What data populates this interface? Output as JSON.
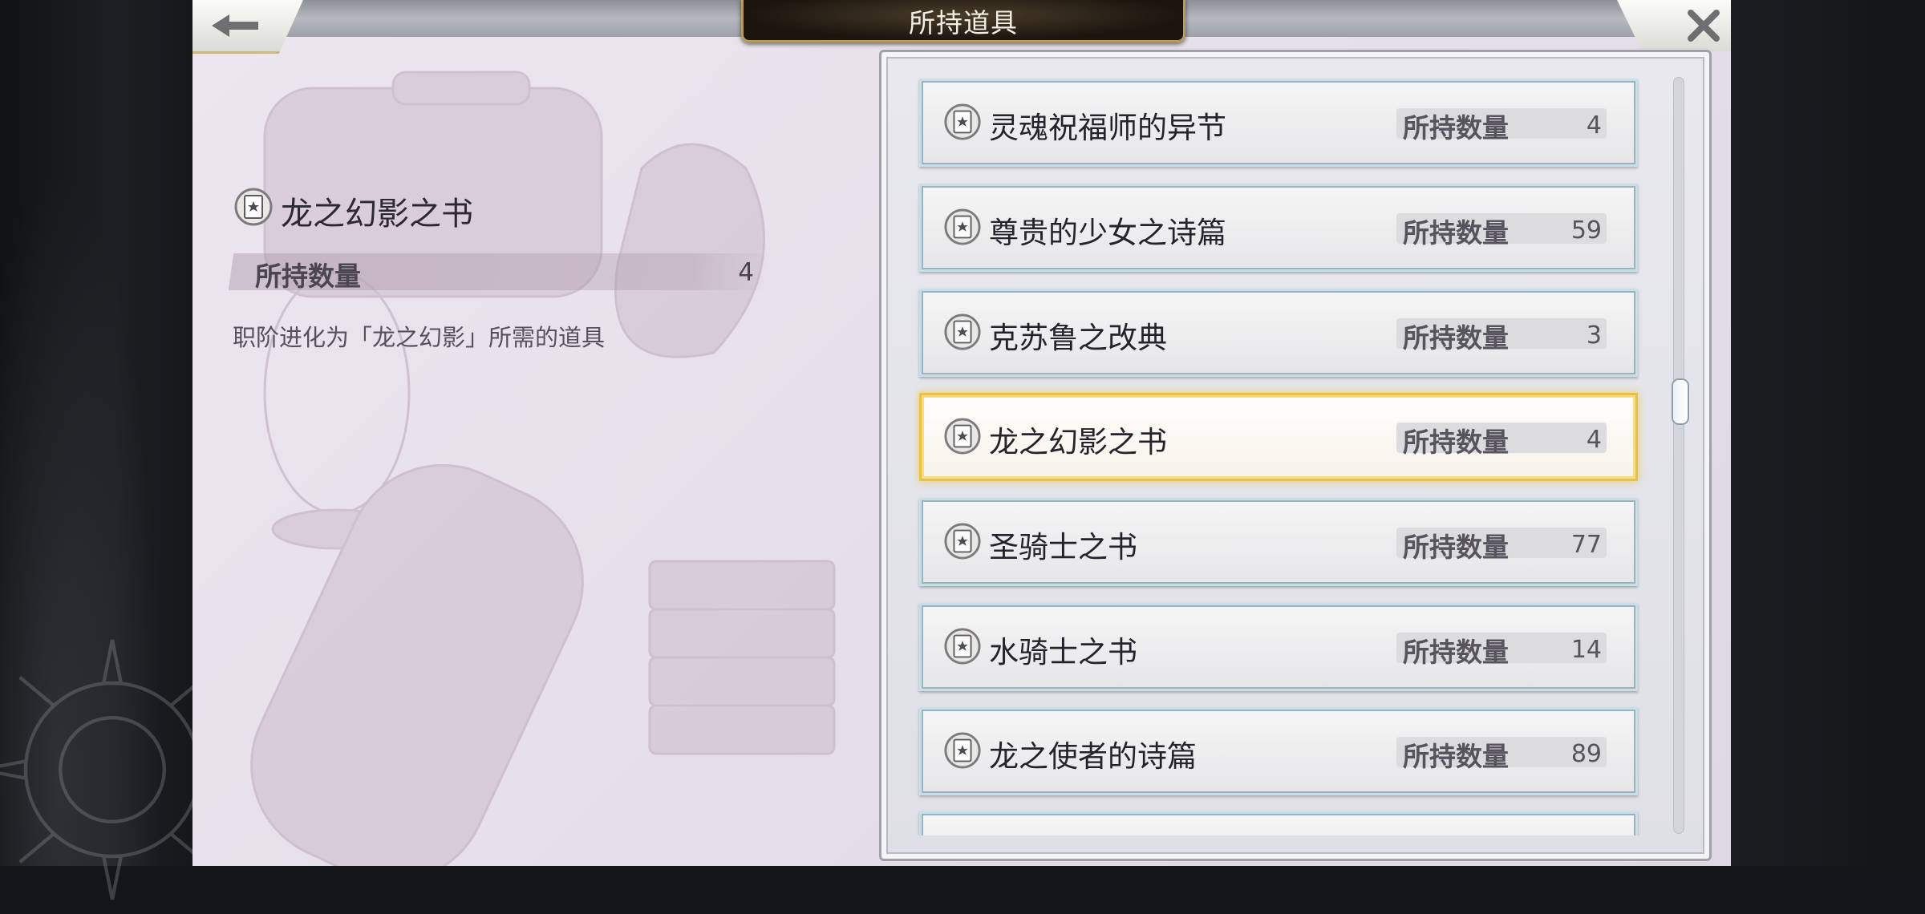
{
  "header": {
    "title": "所持道具"
  },
  "detail": {
    "name": "龙之幻影之书",
    "qty_label": "所持数量",
    "qty_value": "4",
    "description": "职阶进化为「龙之幻影」所需的道具"
  },
  "items": [
    {
      "name": "灵魂祝福师的异节",
      "qty_label": "所持数量",
      "qty": "4"
    },
    {
      "name": "尊贵的少女之诗篇",
      "qty_label": "所持数量",
      "qty": "59"
    },
    {
      "name": "克苏鲁之改典",
      "qty_label": "所持数量",
      "qty": "3"
    },
    {
      "name": "龙之幻影之书",
      "qty_label": "所持数量",
      "qty": "4"
    },
    {
      "name": "圣骑士之书",
      "qty_label": "所持数量",
      "qty": "77"
    },
    {
      "name": "水骑士之书",
      "qty_label": "所持数量",
      "qty": "14"
    },
    {
      "name": "龙之使者的诗篇",
      "qty_label": "所持数量",
      "qty": "89"
    }
  ],
  "selected_index": 3,
  "icons": {
    "back": "arrow-left-icon",
    "close": "close-icon",
    "item": "book-icon"
  },
  "colors": {
    "selected_border": "#e9c245",
    "title_plate": "#1c150e",
    "title_trim": "#b79a5e"
  }
}
